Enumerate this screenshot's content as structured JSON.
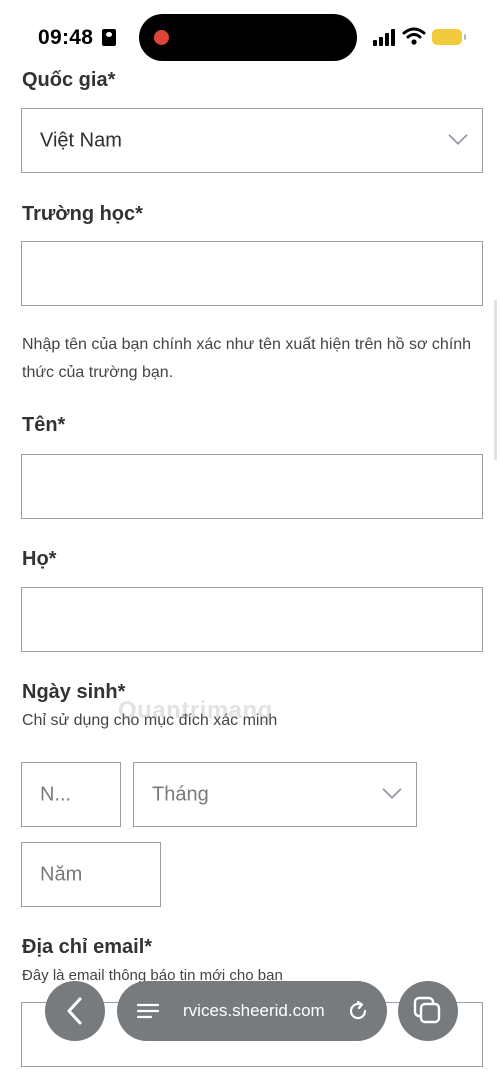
{
  "status_bar": {
    "time": "09:48"
  },
  "form": {
    "country": {
      "label": "Quốc gia*",
      "value": "Việt Nam"
    },
    "school": {
      "label": "Trường học*",
      "value": "",
      "helper": "Nhập tên của bạn chính xác như tên xuất hiện trên hồ sơ chính thức của trường bạn."
    },
    "first_name": {
      "label": "Tên*",
      "value": ""
    },
    "last_name": {
      "label": "Họ*",
      "value": ""
    },
    "birth_date": {
      "label": "Ngày sinh*",
      "helper": "Chỉ sử dụng cho mục đích xác minh",
      "day_placeholder": "N...",
      "month_placeholder": "Tháng",
      "year_placeholder": "Năm"
    },
    "email": {
      "label": "Địa chỉ email*",
      "helper": "Đây là email thông báo tin mới cho bạn",
      "value": ""
    }
  },
  "browser": {
    "url": "rvices.sheerid.com"
  },
  "colors": {
    "field_border": "#9aa0aa",
    "browser_control_bg": "#777b7e",
    "battery": "#f1cb3c",
    "recording_dot": "#e0453a"
  }
}
